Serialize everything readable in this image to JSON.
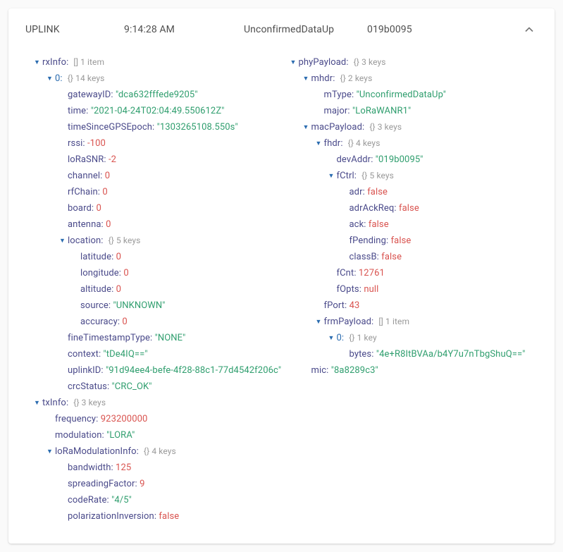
{
  "header": {
    "direction": "UPLINK",
    "time": "9:14:28 AM",
    "type": "UnconfirmedDataUp",
    "addr": "019b0095"
  },
  "left": {
    "rxInfo": [
      {
        "gatewayID": "dca632fffede9205",
        "time": "2021-04-24T02:04:49.550612Z",
        "timeSinceGPSEpoch": "1303265108.550s",
        "rssi": -100,
        "loRaSNR": -2,
        "channel": 0,
        "rfChain": 0,
        "board": 0,
        "antenna": 0,
        "location": {
          "latitude": 0,
          "longitude": 0,
          "altitude": 0,
          "source": "UNKNOWN",
          "accuracy": 0
        },
        "fineTimestampType": "NONE",
        "context": "tDe4IQ==",
        "uplinkID": "91d94ee4-befe-4f28-88c1-77d4542f206c",
        "crcStatus": "CRC_OK"
      }
    ],
    "txInfo": {
      "frequency": 923200000,
      "modulation": "LORA",
      "loRaModulationInfo": {
        "bandwidth": 125,
        "spreadingFactor": 9,
        "codeRate": "4/5",
        "polarizationInversion": false
      }
    }
  },
  "right": {
    "phyPayload": {
      "mhdr": {
        "mType": "UnconfirmedDataUp",
        "major": "LoRaWANR1"
      },
      "macPayload": {
        "fhdr": {
          "devAddr": "019b0095",
          "fCtrl": {
            "adr": false,
            "adrAckReq": false,
            "ack": false,
            "fPending": false,
            "classB": false
          },
          "fCnt": 12761,
          "fOpts": null
        },
        "fPort": 43,
        "frmPayload": [
          {
            "bytes": "4e+R8ItBVAa/b4Y7u7nTbgShuQ=="
          }
        ]
      },
      "mic": "8a8289c3"
    }
  }
}
